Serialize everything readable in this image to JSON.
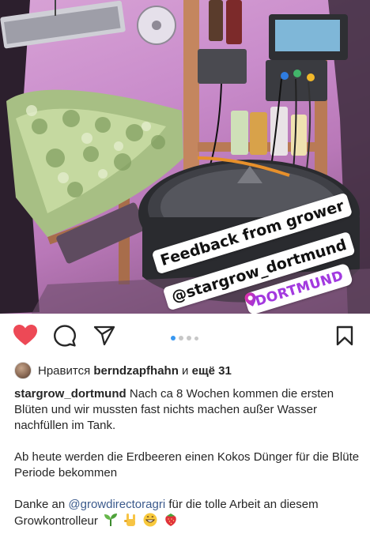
{
  "post": {
    "image": {
      "sticker_line1": "Feedback from grower",
      "sticker_line2": "@stargrow_dortmund",
      "location": "DORTMUND"
    },
    "actions": {
      "like_icon": "heart-filled-icon",
      "comment_icon": "comment-icon",
      "share_icon": "paper-plane-icon",
      "save_icon": "bookmark-icon",
      "like_color": "#ed4956",
      "carousel": {
        "total": 4,
        "active": 1
      }
    },
    "likes": {
      "prefix": "Нравится",
      "user": "berndzapfhahn",
      "joiner": "и",
      "others": "ещё 31"
    },
    "caption": {
      "username": "stargrow_dortmund",
      "paragraph1": "Nach ca 8 Wochen kommen die ersten Blüten und wir mussten fast nichts machen außer Wasser nachfüllen im Tank.",
      "paragraph2": "Ab heute werden die Erdbeeren einen Kokos Dünger für die Blüte Periode bekommen",
      "paragraph3_pre": "Danke an",
      "mention": "@growdirectoragri",
      "paragraph3_post": "für die tolle Arbeit an diesem Growkontrolleur",
      "emojis": [
        "seedling-emoji",
        "sign-of-horns-emoji",
        "grinning-face-emoji",
        "strawberry-emoji"
      ]
    }
  }
}
